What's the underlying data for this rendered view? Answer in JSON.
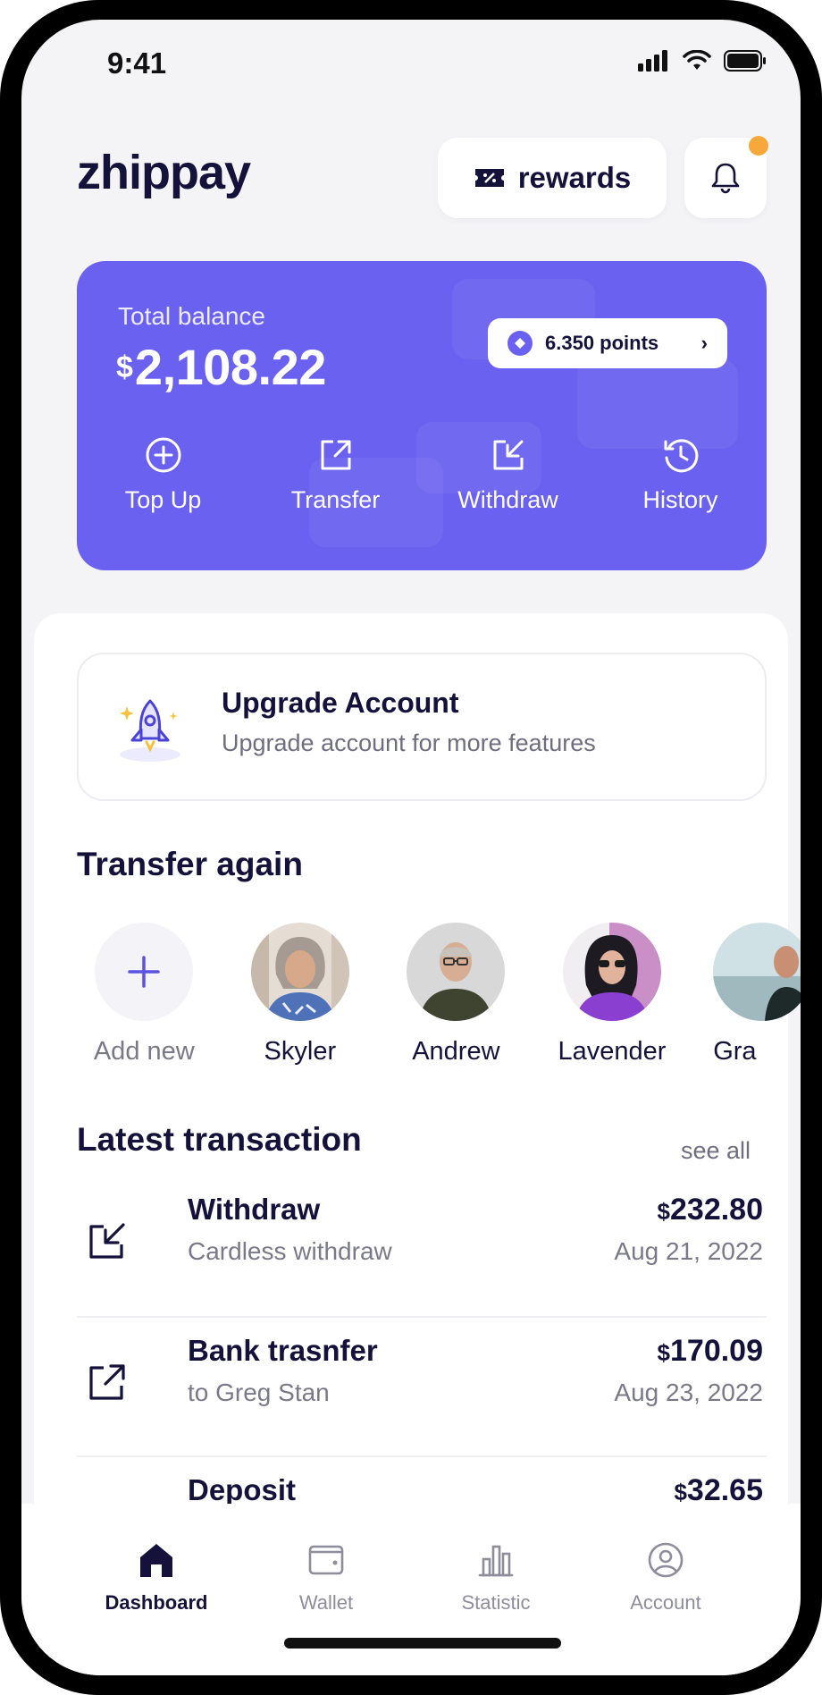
{
  "status_bar": {
    "time": "9:41",
    "icons": [
      "cellular-signal-icon",
      "wifi-icon",
      "battery-icon"
    ]
  },
  "header": {
    "logo": "zhippay",
    "rewards_label": "rewards",
    "notification_icon": "bell-icon",
    "notification_badge_color": "#f7a83a"
  },
  "balance": {
    "label": "Total balance",
    "currency": "$",
    "amount": "2,108.22",
    "points_label": "6.350 points",
    "card_color": "#6b61f1",
    "actions": [
      {
        "label": "Top Up",
        "icon": "plus-circle-icon"
      },
      {
        "label": "Transfer",
        "icon": "arrow-up-right-icon"
      },
      {
        "label": "Withdraw",
        "icon": "arrow-down-left-icon"
      },
      {
        "label": "History",
        "icon": "history-icon"
      }
    ]
  },
  "upgrade": {
    "title": "Upgrade Account",
    "subtitle": "Upgrade account for more features",
    "icon": "rocket-icon"
  },
  "transfer_again": {
    "title": "Transfer again",
    "add_label": "Add new",
    "contacts": [
      {
        "name": "Skyler"
      },
      {
        "name": "Andrew"
      },
      {
        "name": "Lavender"
      },
      {
        "name": "Gra"
      }
    ]
  },
  "transactions": {
    "title": "Latest transaction",
    "see_all": "see all",
    "items": [
      {
        "title": "Withdraw",
        "subtitle": "Cardless withdraw",
        "currency": "$",
        "amount": "232.80",
        "date": "Aug 21, 2022",
        "icon": "arrow-down-left-icon"
      },
      {
        "title": "Bank trasnfer",
        "subtitle": "to Greg Stan",
        "currency": "$",
        "amount": "170.09",
        "date": "Aug 23, 2022",
        "icon": "arrow-up-right-icon"
      },
      {
        "title": "Deposit",
        "subtitle": "",
        "currency": "$",
        "amount": "32.65",
        "date": "",
        "icon": "card-icon"
      }
    ]
  },
  "nav": {
    "items": [
      {
        "label": "Dashboard",
        "icon": "home-icon",
        "active": true
      },
      {
        "label": "Wallet",
        "icon": "wallet-icon",
        "active": false
      },
      {
        "label": "Statistic",
        "icon": "bar-chart-icon",
        "active": false
      },
      {
        "label": "Account",
        "icon": "user-circle-icon",
        "active": false
      }
    ]
  }
}
